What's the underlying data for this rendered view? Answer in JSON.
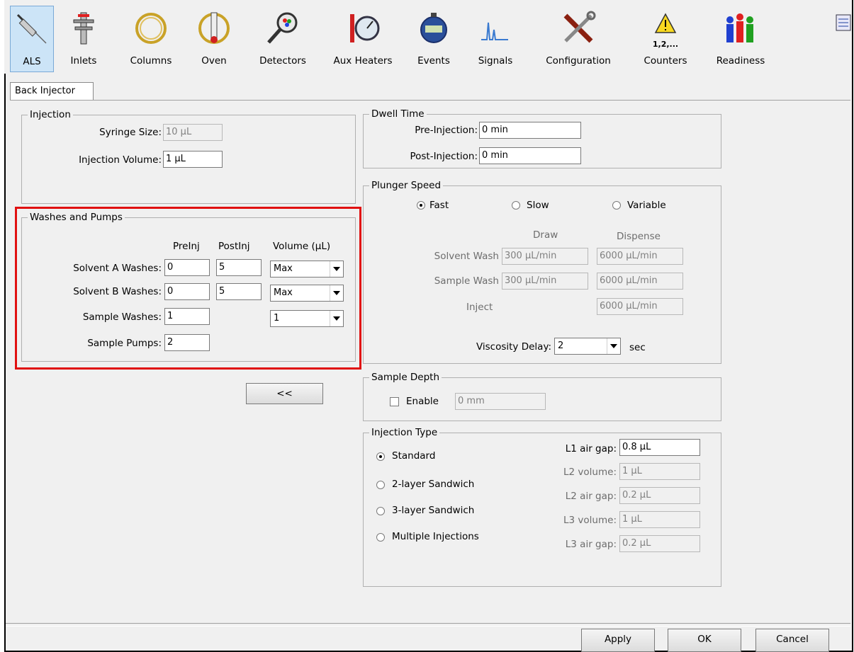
{
  "toolbar": {
    "items": [
      {
        "label": "ALS",
        "icon": "syringe-icon",
        "selected": true
      },
      {
        "label": "Inlets",
        "icon": "inlet-icon"
      },
      {
        "label": "Columns",
        "icon": "column-coil-icon"
      },
      {
        "label": "Oven",
        "icon": "oven-icon"
      },
      {
        "label": "Detectors",
        "icon": "detector-icon"
      },
      {
        "label": "Aux Heaters",
        "icon": "aux-heater-gauge-icon"
      },
      {
        "label": "Events",
        "icon": "stopwatch-icon"
      },
      {
        "label": "Signals",
        "icon": "signal-peaks-icon"
      },
      {
        "label": "Configuration",
        "icon": "tools-icon"
      },
      {
        "label": "Counters",
        "icon": "warning-counter-icon",
        "sub": "1,2,..."
      },
      {
        "label": "Readiness",
        "icon": "readiness-people-icon"
      }
    ]
  },
  "tab": {
    "label": "Back Injector"
  },
  "injection": {
    "title": "Injection",
    "syringe_label": "Syringe Size:",
    "syringe_value": "10 µL",
    "volume_label": "Injection Volume:",
    "volume_value": "1 µL"
  },
  "washes": {
    "title": "Washes and Pumps",
    "col_preinj": "PreInj",
    "col_postinj": "PostInj",
    "col_volume": "Volume (µL)",
    "solvent_a_label": "Solvent A Washes:",
    "solvent_a_pre": "0",
    "solvent_a_post": "5",
    "solvent_a_vol": "Max",
    "solvent_b_label": "Solvent B Washes:",
    "solvent_b_pre": "0",
    "solvent_b_post": "5",
    "solvent_b_vol": "Max",
    "sample_washes_label": "Sample Washes:",
    "sample_washes_pre": "1",
    "sample_washes_vol": "1",
    "sample_pumps_label": "Sample Pumps:",
    "sample_pumps_value": "2"
  },
  "collapse_button": "<<",
  "dwell": {
    "title": "Dwell Time",
    "pre_label": "Pre-Injection:",
    "pre_value": "0 min",
    "post_label": "Post-Injection:",
    "post_value": "0 min"
  },
  "plunger": {
    "title": "Plunger Speed",
    "fast": "Fast",
    "slow": "Slow",
    "variable": "Variable",
    "draw": "Draw",
    "dispense": "Dispense",
    "solvent_wash_label": "Solvent Wash",
    "solvent_wash_draw": "300 µL/min",
    "solvent_wash_dispense": "6000 µL/min",
    "sample_wash_label": "Sample Wash",
    "sample_wash_draw": "300 µL/min",
    "sample_wash_dispense": "6000 µL/min",
    "inject_label": "Inject",
    "inject_dispense": "6000 µL/min",
    "viscosity_label": "Viscosity Delay:",
    "viscosity_value": "2",
    "viscosity_unit": "sec"
  },
  "depth": {
    "title": "Sample Depth",
    "enable_label": "Enable",
    "value": "0 mm"
  },
  "injtype": {
    "title": "Injection Type",
    "standard": "Standard",
    "two_layer": "2-layer Sandwich",
    "three_layer": "3-layer Sandwich",
    "multiple": "Multiple Injections",
    "l1_gap_label": "L1 air gap:",
    "l1_gap_value": "0.8 µL",
    "l2_vol_label": "L2 volume:",
    "l2_vol_value": "1 µL",
    "l2_gap_label": "L2 air gap:",
    "l2_gap_value": "0.2 µL",
    "l3_vol_label": "L3 volume:",
    "l3_vol_value": "1 µL",
    "l3_gap_label": "L3 air gap:",
    "l3_gap_value": "0.2 µL"
  },
  "footer": {
    "apply": "Apply",
    "ok": "OK",
    "cancel": "Cancel"
  },
  "colors": {
    "highlight": "#e01010",
    "selected_tab_bg": "#cce4f7"
  }
}
